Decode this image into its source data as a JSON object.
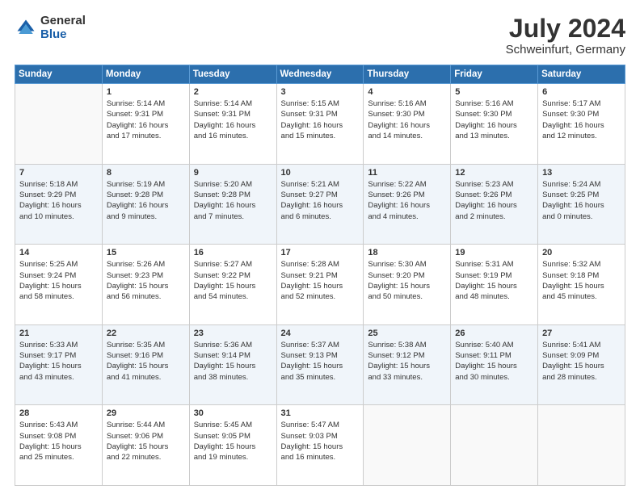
{
  "logo": {
    "general": "General",
    "blue": "Blue"
  },
  "header": {
    "title": "July 2024",
    "subtitle": "Schweinfurt, Germany"
  },
  "weekdays": [
    "Sunday",
    "Monday",
    "Tuesday",
    "Wednesday",
    "Thursday",
    "Friday",
    "Saturday"
  ],
  "weeks": [
    [
      {
        "day": "",
        "info": ""
      },
      {
        "day": "1",
        "info": "Sunrise: 5:14 AM\nSunset: 9:31 PM\nDaylight: 16 hours\nand 17 minutes."
      },
      {
        "day": "2",
        "info": "Sunrise: 5:14 AM\nSunset: 9:31 PM\nDaylight: 16 hours\nand 16 minutes."
      },
      {
        "day": "3",
        "info": "Sunrise: 5:15 AM\nSunset: 9:31 PM\nDaylight: 16 hours\nand 15 minutes."
      },
      {
        "day": "4",
        "info": "Sunrise: 5:16 AM\nSunset: 9:30 PM\nDaylight: 16 hours\nand 14 minutes."
      },
      {
        "day": "5",
        "info": "Sunrise: 5:16 AM\nSunset: 9:30 PM\nDaylight: 16 hours\nand 13 minutes."
      },
      {
        "day": "6",
        "info": "Sunrise: 5:17 AM\nSunset: 9:30 PM\nDaylight: 16 hours\nand 12 minutes."
      }
    ],
    [
      {
        "day": "7",
        "info": "Sunrise: 5:18 AM\nSunset: 9:29 PM\nDaylight: 16 hours\nand 10 minutes."
      },
      {
        "day": "8",
        "info": "Sunrise: 5:19 AM\nSunset: 9:28 PM\nDaylight: 16 hours\nand 9 minutes."
      },
      {
        "day": "9",
        "info": "Sunrise: 5:20 AM\nSunset: 9:28 PM\nDaylight: 16 hours\nand 7 minutes."
      },
      {
        "day": "10",
        "info": "Sunrise: 5:21 AM\nSunset: 9:27 PM\nDaylight: 16 hours\nand 6 minutes."
      },
      {
        "day": "11",
        "info": "Sunrise: 5:22 AM\nSunset: 9:26 PM\nDaylight: 16 hours\nand 4 minutes."
      },
      {
        "day": "12",
        "info": "Sunrise: 5:23 AM\nSunset: 9:26 PM\nDaylight: 16 hours\nand 2 minutes."
      },
      {
        "day": "13",
        "info": "Sunrise: 5:24 AM\nSunset: 9:25 PM\nDaylight: 16 hours\nand 0 minutes."
      }
    ],
    [
      {
        "day": "14",
        "info": "Sunrise: 5:25 AM\nSunset: 9:24 PM\nDaylight: 15 hours\nand 58 minutes."
      },
      {
        "day": "15",
        "info": "Sunrise: 5:26 AM\nSunset: 9:23 PM\nDaylight: 15 hours\nand 56 minutes."
      },
      {
        "day": "16",
        "info": "Sunrise: 5:27 AM\nSunset: 9:22 PM\nDaylight: 15 hours\nand 54 minutes."
      },
      {
        "day": "17",
        "info": "Sunrise: 5:28 AM\nSunset: 9:21 PM\nDaylight: 15 hours\nand 52 minutes."
      },
      {
        "day": "18",
        "info": "Sunrise: 5:30 AM\nSunset: 9:20 PM\nDaylight: 15 hours\nand 50 minutes."
      },
      {
        "day": "19",
        "info": "Sunrise: 5:31 AM\nSunset: 9:19 PM\nDaylight: 15 hours\nand 48 minutes."
      },
      {
        "day": "20",
        "info": "Sunrise: 5:32 AM\nSunset: 9:18 PM\nDaylight: 15 hours\nand 45 minutes."
      }
    ],
    [
      {
        "day": "21",
        "info": "Sunrise: 5:33 AM\nSunset: 9:17 PM\nDaylight: 15 hours\nand 43 minutes."
      },
      {
        "day": "22",
        "info": "Sunrise: 5:35 AM\nSunset: 9:16 PM\nDaylight: 15 hours\nand 41 minutes."
      },
      {
        "day": "23",
        "info": "Sunrise: 5:36 AM\nSunset: 9:14 PM\nDaylight: 15 hours\nand 38 minutes."
      },
      {
        "day": "24",
        "info": "Sunrise: 5:37 AM\nSunset: 9:13 PM\nDaylight: 15 hours\nand 35 minutes."
      },
      {
        "day": "25",
        "info": "Sunrise: 5:38 AM\nSunset: 9:12 PM\nDaylight: 15 hours\nand 33 minutes."
      },
      {
        "day": "26",
        "info": "Sunrise: 5:40 AM\nSunset: 9:11 PM\nDaylight: 15 hours\nand 30 minutes."
      },
      {
        "day": "27",
        "info": "Sunrise: 5:41 AM\nSunset: 9:09 PM\nDaylight: 15 hours\nand 28 minutes."
      }
    ],
    [
      {
        "day": "28",
        "info": "Sunrise: 5:43 AM\nSunset: 9:08 PM\nDaylight: 15 hours\nand 25 minutes."
      },
      {
        "day": "29",
        "info": "Sunrise: 5:44 AM\nSunset: 9:06 PM\nDaylight: 15 hours\nand 22 minutes."
      },
      {
        "day": "30",
        "info": "Sunrise: 5:45 AM\nSunset: 9:05 PM\nDaylight: 15 hours\nand 19 minutes."
      },
      {
        "day": "31",
        "info": "Sunrise: 5:47 AM\nSunset: 9:03 PM\nDaylight: 15 hours\nand 16 minutes."
      },
      {
        "day": "",
        "info": ""
      },
      {
        "day": "",
        "info": ""
      },
      {
        "day": "",
        "info": ""
      }
    ]
  ]
}
